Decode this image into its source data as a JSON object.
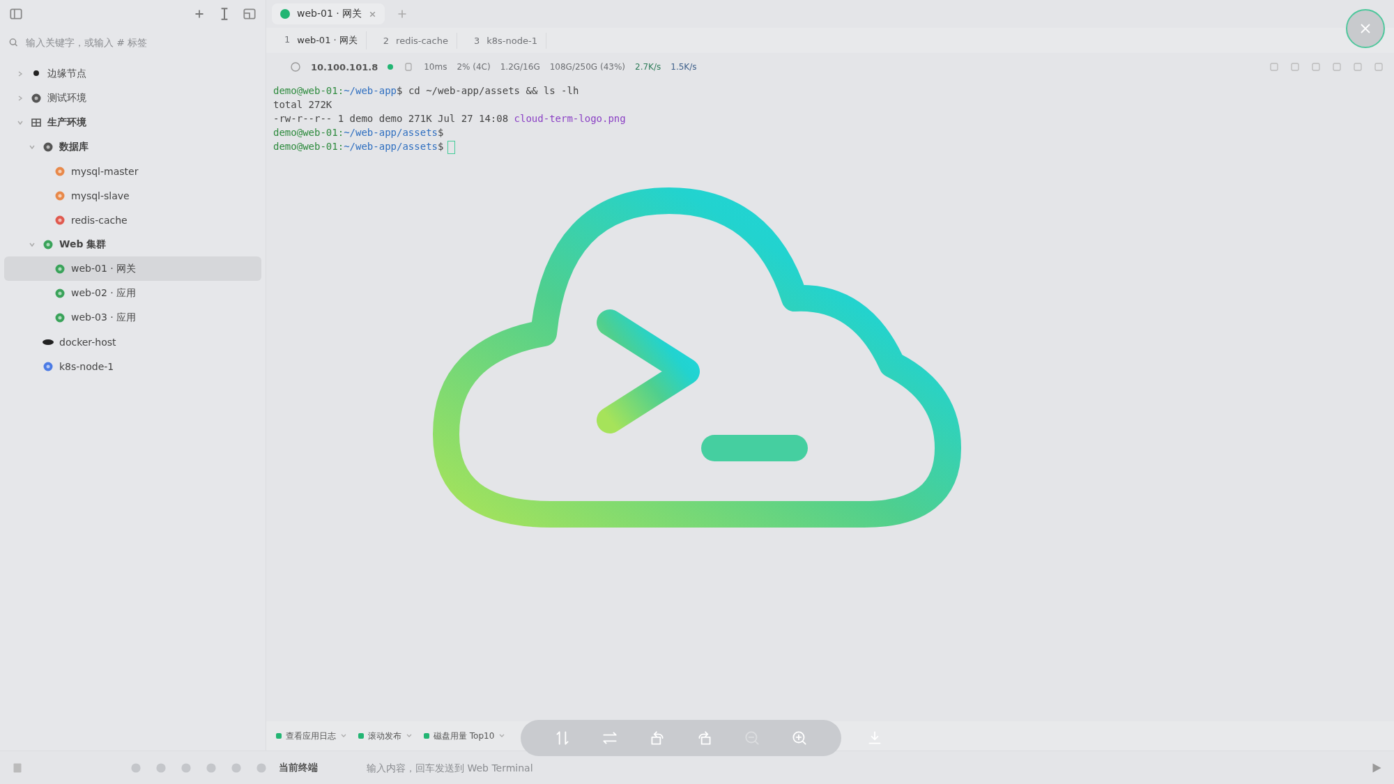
{
  "sidebar": {
    "search": {
      "placeholder": "输入关键字，或输入 # 标签"
    },
    "tree": [
      {
        "label": "边缘节点",
        "kind": "dot",
        "expanded": false
      },
      {
        "label": "测试环境",
        "kind": "globe",
        "expanded": false
      },
      {
        "label": "生产环境",
        "kind": "grid",
        "expanded": true,
        "children": [
          {
            "label": "数据库",
            "kind": "db",
            "expanded": true,
            "children": [
              {
                "label": "mysql-master",
                "kind": "mysql",
                "selected": false
              },
              {
                "label": "mysql-slave",
                "kind": "mysql",
                "selected": false
              },
              {
                "label": "redis-cache",
                "kind": "redis",
                "selected": false
              }
            ]
          },
          {
            "label": "Web 集群",
            "kind": "web",
            "expanded": true,
            "children": [
              {
                "label": "web-01 · 网关",
                "kind": "web",
                "selected": true
              },
              {
                "label": "web-02 · 应用",
                "kind": "web",
                "selected": false
              },
              {
                "label": "web-03 · 应用",
                "kind": "web",
                "selected": false
              }
            ]
          },
          {
            "label": "docker-host",
            "kind": "docker",
            "selected": false
          },
          {
            "label": "k8s-node-1",
            "kind": "k8s",
            "selected": false
          }
        ]
      }
    ]
  },
  "tabs": [
    {
      "label": "web-01 · 网关",
      "selected": true,
      "color": "#22b573"
    }
  ],
  "session_tabs": [
    {
      "index": "1",
      "label": "web-01 · 网关",
      "selected": true
    },
    {
      "index": "2",
      "label": "redis-cache",
      "selected": false
    },
    {
      "index": "3",
      "label": "k8s-node-1",
      "selected": false
    }
  ],
  "status_bar": {
    "host": "10.100.101.8",
    "latency": "10ms",
    "cpu": "2% (4C)",
    "memory": "1.2G/16G",
    "disk": "108G/250G (43%)",
    "download": "2.7K/s",
    "upload": "1.5K/s"
  },
  "terminal": {
    "lines": [
      {
        "kind": "prompt",
        "user": "demo@web-01:",
        "path": "~/web-app",
        "symbol": "$",
        "command": "cd ~/web-app/assets && ls -lh"
      },
      {
        "kind": "output",
        "text": "total 272K"
      },
      {
        "kind": "file",
        "meta": "-rw-r--r-- 1 demo demo 271K Jul 27 14:08",
        "name": "cloud-term-logo.png"
      },
      {
        "kind": "prompt",
        "user": "demo@web-01:",
        "path": "~/web-app/assets",
        "symbol": "$"
      },
      {
        "kind": "cursor",
        "user": "demo@web-01:",
        "path": "~/web-app/assets",
        "symbol": "$"
      }
    ]
  },
  "quick_commands": [
    {
      "label": "查看应用日志"
    },
    {
      "label": "滚动发布"
    },
    {
      "label": "磁盘用量 Top10"
    }
  ],
  "input_bar": {
    "target": "当前终端",
    "placeholder": "输入内容，回车发送到 Web Terminal"
  },
  "image_viewer": {
    "tools": [
      {
        "kind": "flip-vertical",
        "disabled": false
      },
      {
        "kind": "flip-horizontal",
        "disabled": false
      },
      {
        "kind": "rotate-left",
        "disabled": false
      },
      {
        "kind": "rotate-right",
        "disabled": false
      },
      {
        "kind": "zoom-out",
        "disabled": true
      },
      {
        "kind": "zoom-in",
        "disabled": false
      }
    ]
  }
}
